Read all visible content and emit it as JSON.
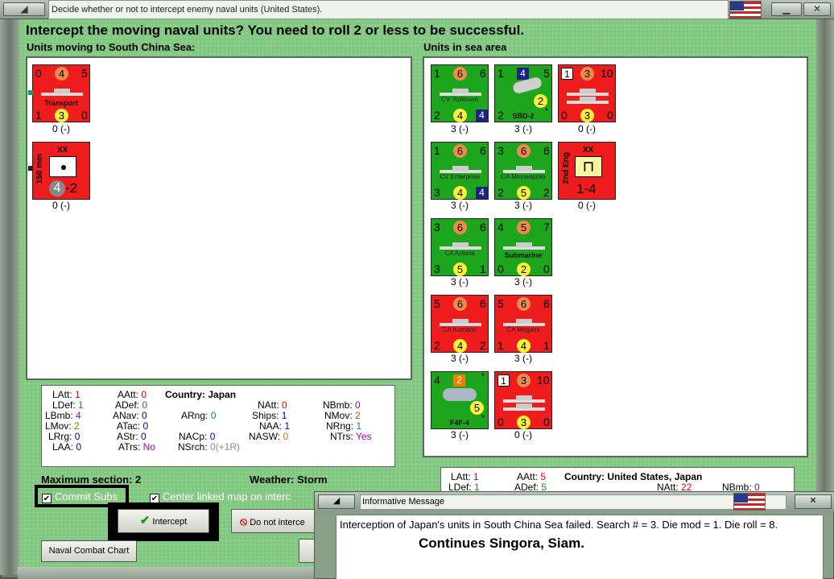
{
  "window": {
    "title": "Decide whether or not to intercept enemy naval units (United States)."
  },
  "heading": "Intercept the moving naval units?  You need to roll 2 or less to be successful.",
  "left_header": "Units moving to South China Sea:",
  "right_header": "Units in sea area",
  "moving_units": [
    {
      "v": [
        "0",
        "4",
        "5",
        "1",
        "3",
        "0"
      ],
      "name": "Transport",
      "label": "0 (-)"
    },
    {
      "v": [
        "150 mm",
        "XX",
        "4",
        "-2"
      ],
      "label": "0 (-)"
    }
  ],
  "sea_units": [
    {
      "v": [
        "1",
        "6",
        "6",
        "2",
        "4",
        "4"
      ],
      "name": "CV Yorktown",
      "label": "3 (-)"
    },
    {
      "v": [
        "1",
        "4",
        "5",
        "2",
        "2",
        "*"
      ],
      "name": "SBD-2",
      "label": "3 (-)"
    },
    {
      "v": [
        "1",
        "3",
        "10",
        "0",
        "3",
        "0"
      ],
      "name": "",
      "label": "0 (-)"
    },
    {
      "v": [
        "1",
        "6",
        "6",
        "3",
        "4",
        "4"
      ],
      "name": "CV Enterprise",
      "label": "3 (-)"
    },
    {
      "v": [
        "3",
        "6",
        "6",
        "2",
        "5",
        "2"
      ],
      "name": "CA Minneapolis",
      "label": "3 (-)"
    },
    {
      "v": [
        "2nd Eng",
        "XX",
        "1-4"
      ],
      "name": "",
      "label": "0 (-)"
    },
    {
      "v": [
        "3",
        "6",
        "6",
        "3",
        "5",
        "1"
      ],
      "name": "CA Astoria",
      "label": "3 (-)"
    },
    {
      "v": [
        "4",
        "5",
        "7",
        "0",
        "2",
        "0"
      ],
      "name": "Submarine",
      "label": "3 (-)"
    },
    {
      "v": [
        "5",
        "6",
        "6",
        "2",
        "4",
        "2"
      ],
      "name": "CA Kumano",
      "label": "3 (-)"
    },
    {
      "v": [
        "5",
        "6",
        "6",
        "1",
        "4",
        "1"
      ],
      "name": "CA Mogami",
      "label": "3 (-)"
    },
    {
      "v": [
        "4",
        "2",
        "*",
        "5",
        "*"
      ],
      "name": "F4F-4",
      "label": "3 (-)"
    },
    {
      "v": [
        "1",
        "3",
        "10",
        "0",
        "3",
        "0"
      ],
      "name": "",
      "label": "0 (-)"
    }
  ],
  "stats_left": {
    "LAtt": "1",
    "LDef": "1",
    "LBmb": "4",
    "LMov": "2",
    "LRrg": "0",
    "LAA": "0",
    "AAtt": "0",
    "ADef": "0",
    "ANav": "0",
    "ATac": "0",
    "AStr": "0",
    "ATrs": "No",
    "country_label": "Country:",
    "country": "Japan",
    "ARng": "0",
    "NACp": "0",
    "NSrch": "0(+1R)",
    "NAtt": "0",
    "Ships": "1",
    "NAA": "1",
    "NASW": "0",
    "NBmb": "0",
    "NMov": "2",
    "NRng": "1",
    "NTrs": "Yes"
  },
  "stats_right": {
    "LAtt": "1",
    "LDef": "1",
    "AAtt": "5",
    "ADef": "5",
    "country_label": "Country:",
    "country": "United States, Japan",
    "NAtt": "22",
    "NBmb": "0"
  },
  "max_section": "Maximum section: 2",
  "weather": "Weather:  Storm",
  "commit_subs": "Commit Subs",
  "center_linked": "Center linked map on interc",
  "intercept_btn": "Intercept",
  "no_intercept_btn": "Do not interce",
  "naval_chart_btn": "Naval Combat Chart",
  "message": {
    "title": "Informative Message",
    "text": "Interception of Japan's units in South China Sea failed.  Search # = 3.  Die mod = 1.  Die roll = 8.",
    "overlay": "Continues Singora, Siam."
  }
}
